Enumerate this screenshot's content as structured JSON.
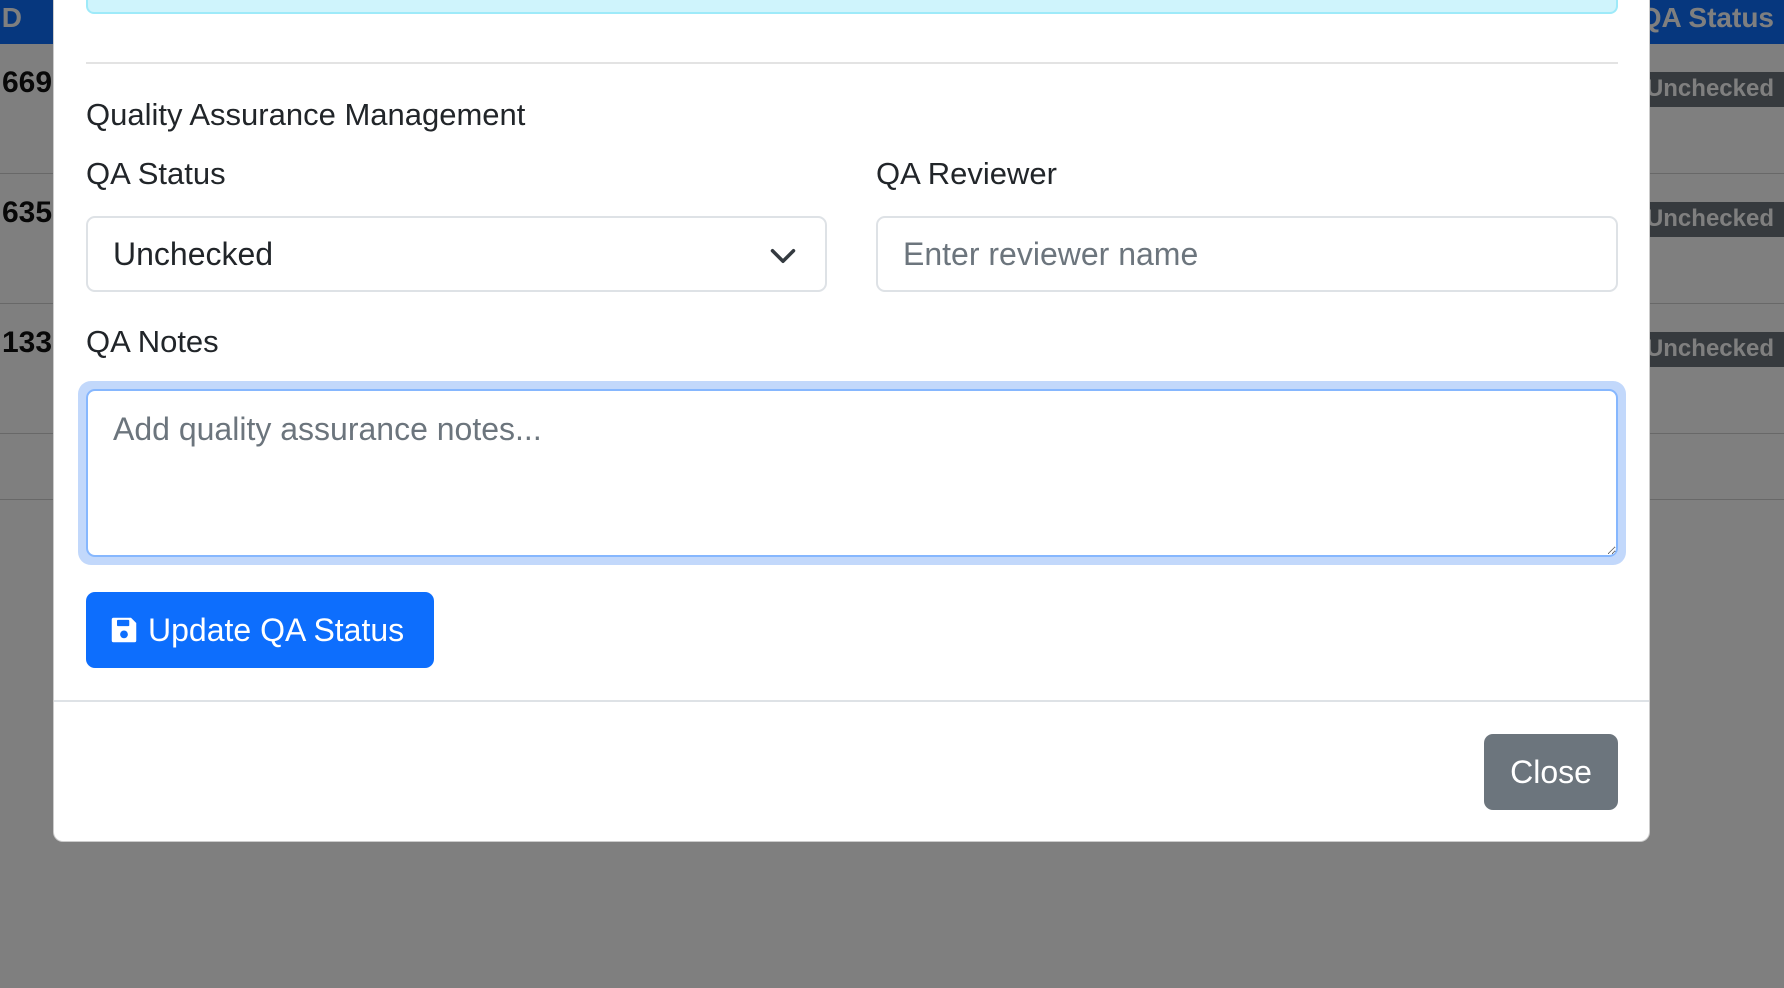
{
  "background_table": {
    "header_left": "ID",
    "header_right": "QA Status",
    "rows": [
      {
        "id": "669",
        "status": "Unchecked"
      },
      {
        "id": "635",
        "status": "Unchecked"
      },
      {
        "id": "133",
        "status": "Unchecked"
      }
    ]
  },
  "modal": {
    "section_title": "Quality Assurance Management",
    "qa_status": {
      "label": "QA Status",
      "selected": "Unchecked"
    },
    "qa_reviewer": {
      "label": "QA Reviewer",
      "placeholder": "Enter reviewer name",
      "value": ""
    },
    "qa_notes": {
      "label": "QA Notes",
      "placeholder": "Add quality assurance notes...",
      "value": ""
    },
    "update_button": {
      "label": "Update QA Status",
      "icon": "save-icon"
    },
    "close_button": {
      "label": "Close"
    }
  },
  "colors": {
    "primary": "#0d6efd",
    "secondary": "#6c757d",
    "info_alert": "#cff4fc",
    "focus_ring": "#86b7fe",
    "backdrop": "rgba(0,0,0,0.5)"
  }
}
